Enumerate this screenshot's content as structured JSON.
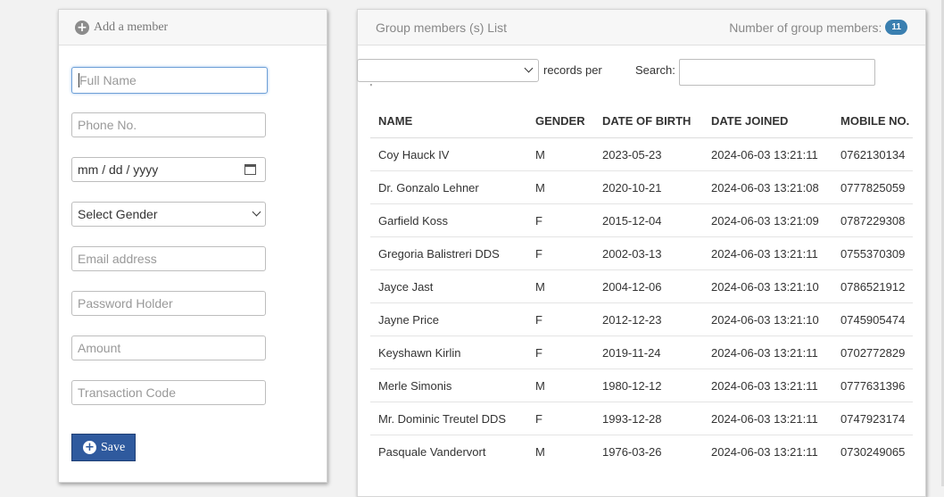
{
  "add_member": {
    "title": "Add a member",
    "fields": {
      "full_name": "Full Name",
      "phone": "Phone No.",
      "dob": "mm / dd / yyyy",
      "gender": "Select Gender",
      "email": "Email address",
      "password": "Password Holder",
      "amount": "Amount",
      "transaction": "Transaction Code"
    },
    "save_label": "Save"
  },
  "members_list": {
    "title": "Group members (s) List",
    "count_label": "Number of group members:",
    "count": "11",
    "records_label": "records per",
    "records_tail": "'",
    "search_label": "Search:",
    "columns": [
      "NAME",
      "GENDER",
      "DATE OF BIRTH",
      "DATE JOINED",
      "MOBILE NO."
    ],
    "rows": [
      [
        "Coy Hauck IV",
        "M",
        "2023-05-23",
        "2024-06-03 13:21:11",
        "0762130134"
      ],
      [
        "Dr. Gonzalo Lehner",
        "M",
        "2020-10-21",
        "2024-06-03 13:21:08",
        "0777825059"
      ],
      [
        "Garfield Koss",
        "F",
        "2015-12-04",
        "2024-06-03 13:21:09",
        "0787229308"
      ],
      [
        "Gregoria Balistreri DDS",
        "F",
        "2002-03-13",
        "2024-06-03 13:21:11",
        "0755370309"
      ],
      [
        "Jayce Jast",
        "M",
        "2004-12-06",
        "2024-06-03 13:21:10",
        "0786521912"
      ],
      [
        "Jayne Price",
        "F",
        "2012-12-23",
        "2024-06-03 13:21:10",
        "0745905474"
      ],
      [
        "Keyshawn Kirlin",
        "F",
        "2019-11-24",
        "2024-06-03 13:21:11",
        "0702772829"
      ],
      [
        "Merle Simonis",
        "M",
        "1980-12-12",
        "2024-06-03 13:21:11",
        "0777631396"
      ],
      [
        "Mr. Dominic Treutel DDS",
        "F",
        "1993-12-28",
        "2024-06-03 13:21:11",
        "0747923174"
      ],
      [
        "Pasquale Vandervort",
        "M",
        "1976-03-26",
        "2024-06-03 13:21:11",
        "0730249065"
      ]
    ]
  },
  "icons": {
    "add": "plus-circle-icon",
    "calendar": "calendar-icon",
    "dropdown": "chevron-down-icon"
  },
  "colors": {
    "save_button": "#2f5a9e",
    "badge": "#3a7fb0"
  }
}
